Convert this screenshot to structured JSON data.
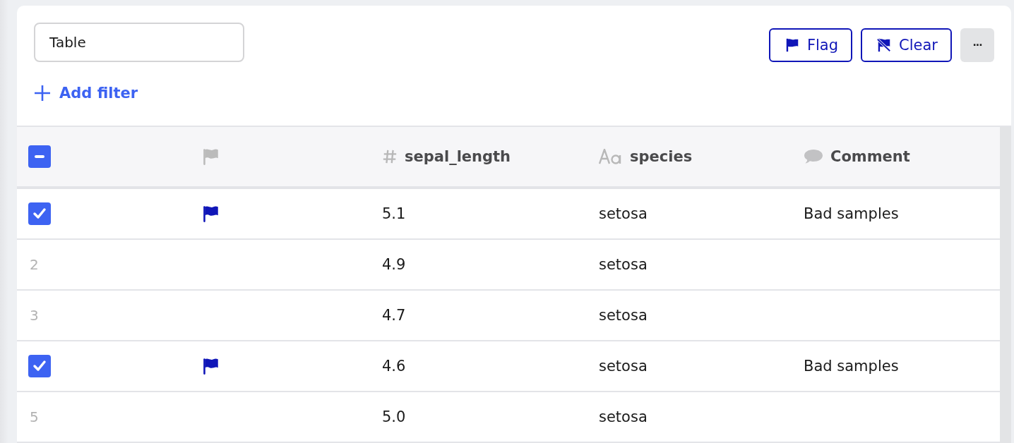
{
  "name_field": {
    "value": "Table"
  },
  "actions": [
    {
      "kind": "flag",
      "label": "Flag"
    },
    {
      "kind": "clear",
      "label": "Clear"
    },
    {
      "kind": "more",
      "label": "···"
    }
  ],
  "add_filter": {
    "label": "Add filter"
  },
  "table": {
    "select_all": {
      "indeterminate": true
    },
    "columns": [
      {
        "kind": "flag"
      },
      {
        "kind": "number",
        "label": "sepal_length"
      },
      {
        "kind": "text",
        "label": "species"
      },
      {
        "kind": "comment",
        "label": "Comment"
      }
    ],
    "rows": [
      {
        "checked": true,
        "flagged": true,
        "sepal_length": "5.1",
        "species": "setosa",
        "comment": "Bad samples"
      },
      {
        "checked": false,
        "number": "2",
        "flagged": false,
        "sepal_length": "4.9",
        "species": "setosa"
      },
      {
        "checked": false,
        "number": "3",
        "flagged": false,
        "sepal_length": "4.7",
        "species": "setosa"
      },
      {
        "checked": true,
        "flagged": true,
        "sepal_length": "4.6",
        "species": "setosa",
        "comment": "Bad samples"
      },
      {
        "checked": false,
        "number": "5",
        "flagged": false,
        "sepal_length": "5.0",
        "species": "setosa"
      }
    ]
  }
}
